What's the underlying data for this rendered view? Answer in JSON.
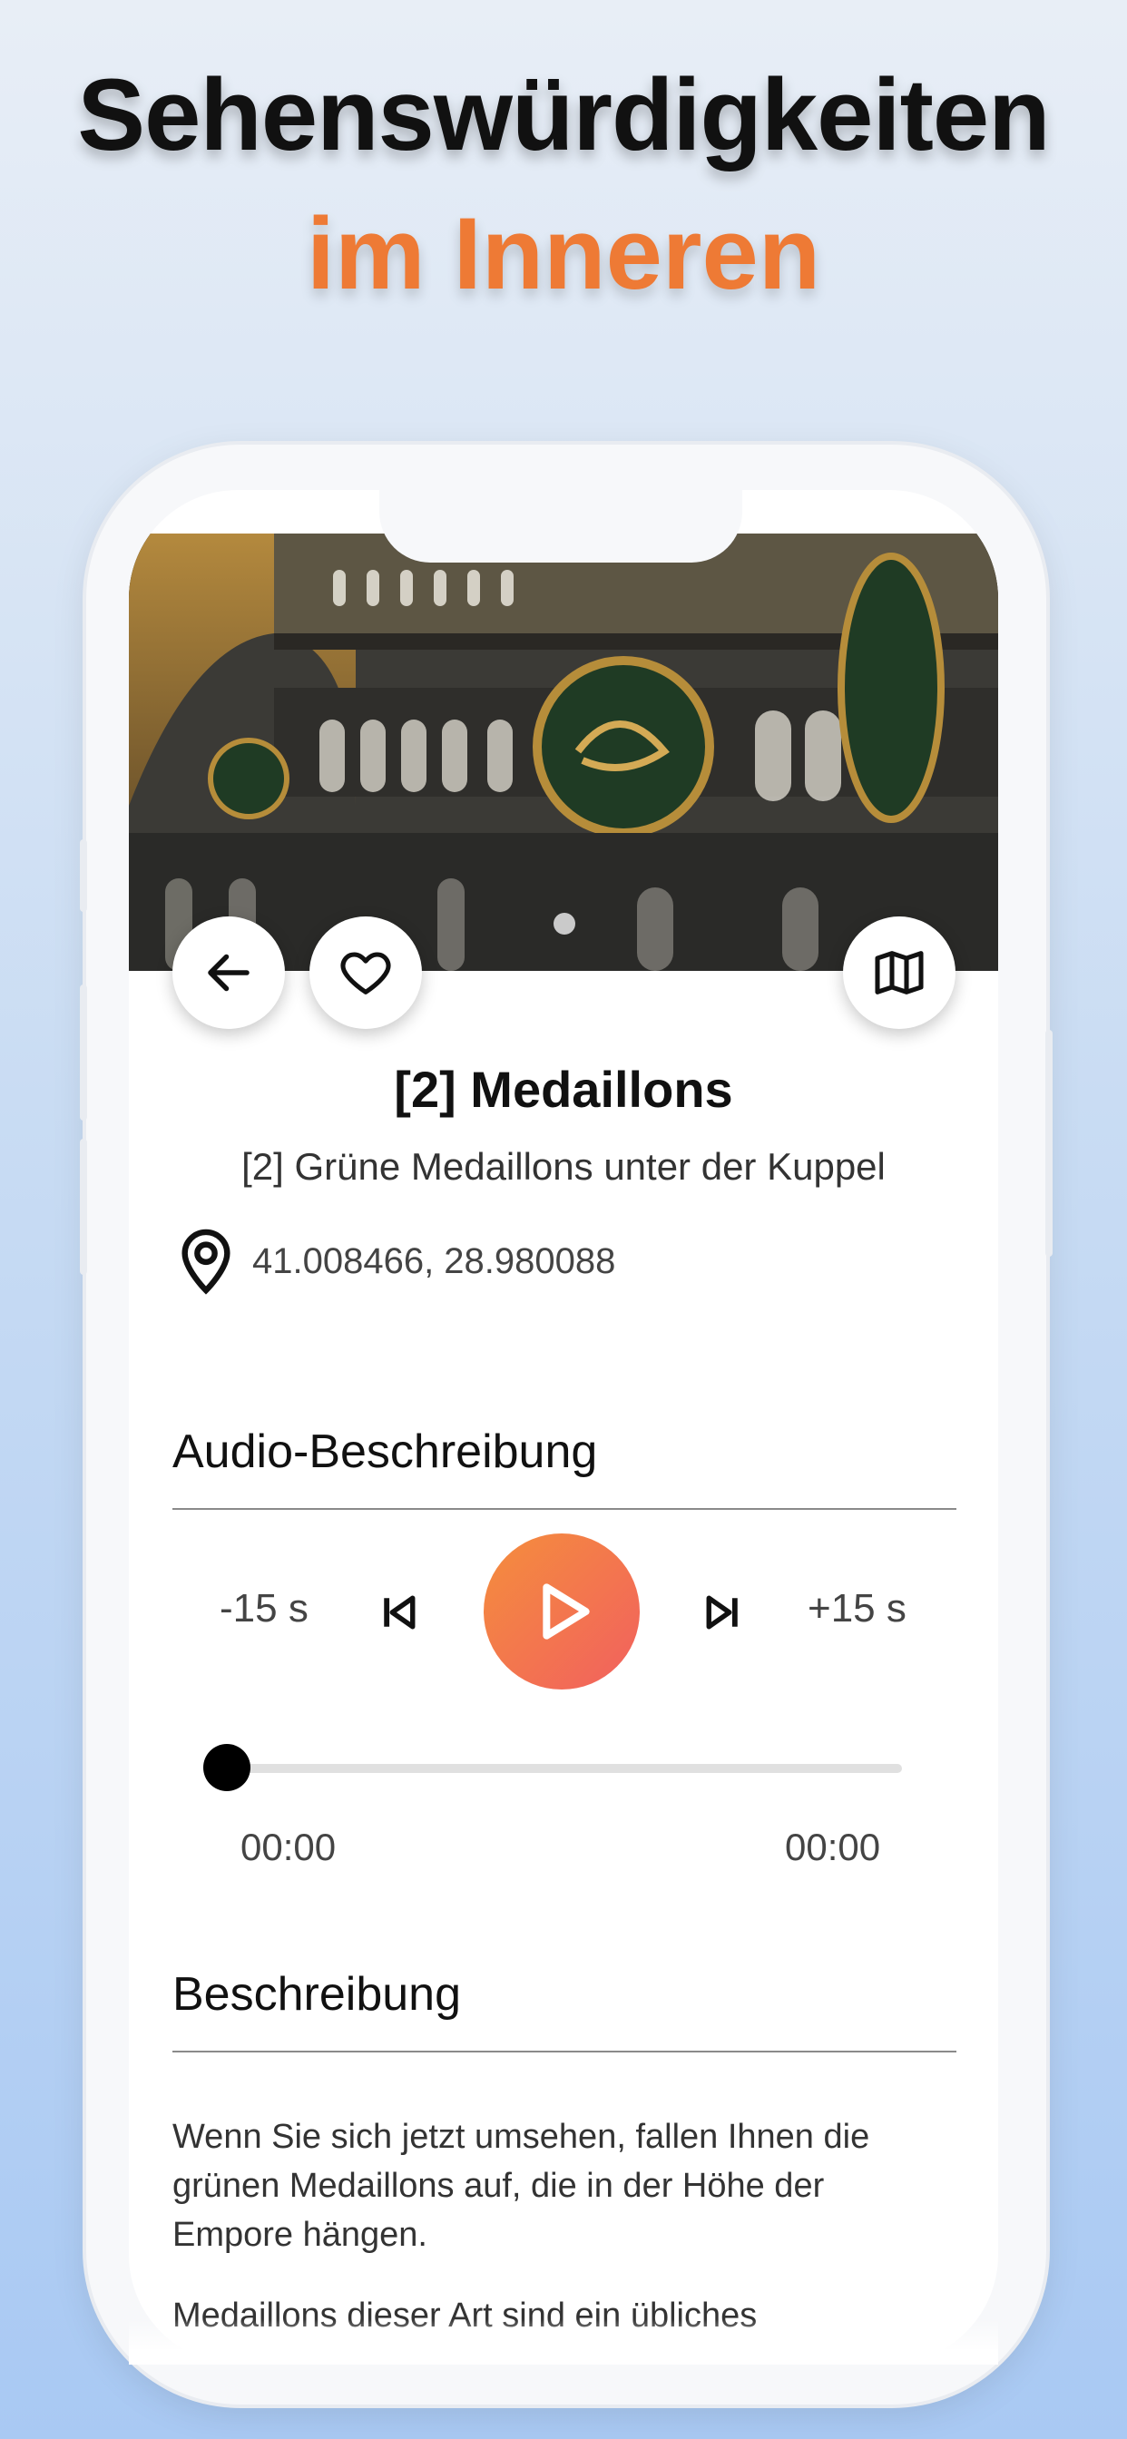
{
  "headline": {
    "line1": "Sehenswürdigkeiten",
    "line2": "im Inneren"
  },
  "colors": {
    "accent_orange": "#ee7a35",
    "play_gradient_start": "#f48e3c",
    "play_gradient_end": "#f2605f"
  },
  "detail": {
    "title": "[2] Medaillons",
    "subtitle": "[2] Grüne Medaillons unter der Kuppel",
    "coordinates": "41.008466, 28.980088"
  },
  "audio": {
    "heading": "Audio-Beschreibung",
    "rewind_label": "-15 s",
    "forward_label": "+15 s",
    "progress": 0,
    "time_current": "00:00",
    "time_total": "00:00"
  },
  "description": {
    "heading": "Beschreibung",
    "paragraph1": "Wenn Sie sich jetzt umsehen, fallen Ihnen die grünen Medaillons auf, die in der Höhe der Empore hängen.",
    "paragraph2": "Medaillons dieser Art sind ein übliches"
  },
  "icons": {
    "back": "arrow-left-icon",
    "favorite": "heart-icon",
    "map": "map-icon",
    "location": "location-pin-icon",
    "previous": "skip-previous-icon",
    "play": "play-icon",
    "next": "skip-next-icon"
  }
}
